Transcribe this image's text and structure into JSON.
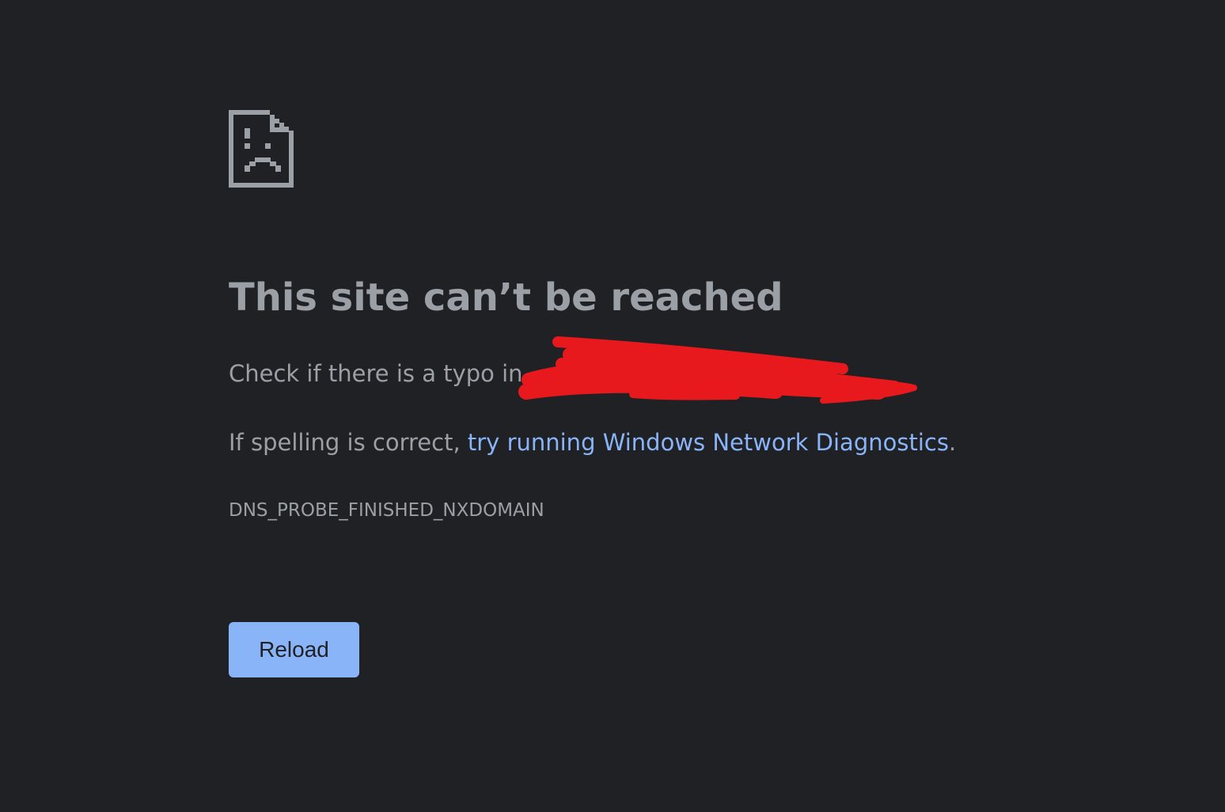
{
  "error_page": {
    "icon": "sad-page-icon",
    "heading": "This site can’t be reached",
    "typo_text": "Check if there is a typo in",
    "spelling_prefix": "If spelling is correct, ",
    "diagnostics_link": "try running Windows Network Diagnostics",
    "spelling_suffix": ".",
    "error_code": "DNS_PROBE_FINISHED_NXDOMAIN",
    "reload_label": "Reload"
  },
  "colors": {
    "background": "#202124",
    "text": "#9aa0a6",
    "link": "#8ab4f8",
    "button": "#8ab4f8",
    "redaction": "#e8191c"
  }
}
